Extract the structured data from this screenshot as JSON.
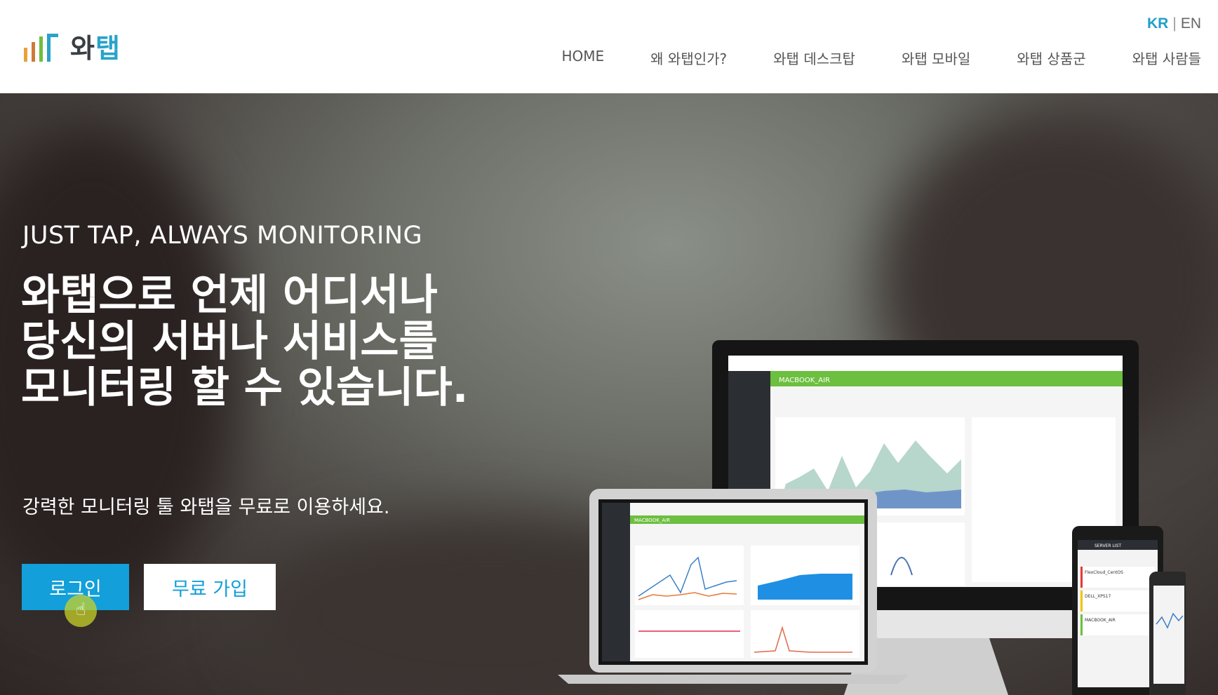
{
  "brand": {
    "name_prefix": "와",
    "name_accent": "탭"
  },
  "lang": {
    "kr": "KR",
    "separator": "|",
    "en": "EN"
  },
  "nav": {
    "items": [
      "HOME",
      "왜 와탭인가?",
      "와탭 데스크탑",
      "와탭 모바일",
      "와탭 상품군",
      "와탭 사람들"
    ]
  },
  "hero": {
    "tagline": "JUST TAP, ALWAYS MONITORING",
    "title_lines": [
      "와탭으로 언제 어디서나",
      "당신의 서버나 서비스를",
      "모니터링 할 수 있습니다."
    ],
    "subtitle": "강력한 모니터링 툴 와탭을 무료로 이용하세요.",
    "login_label": "로그인",
    "signup_label": "무료 가입"
  },
  "mockup": {
    "monitor_title": "MACBOOK_AIR",
    "laptop_title": "MACBOOK_AIR",
    "phone_header": "SERVER LIST",
    "phone_servers": [
      "FlexCloud_CentOS",
      "DELL_XPS17",
      "MACBOOK_AIR"
    ],
    "accent_color": "#6cbf3f",
    "status_colors": [
      "#e53935",
      "#f2c200",
      "#6cbf3f"
    ]
  },
  "colors": {
    "primary": "#129fda",
    "logo_accent": "#29a3c9"
  }
}
